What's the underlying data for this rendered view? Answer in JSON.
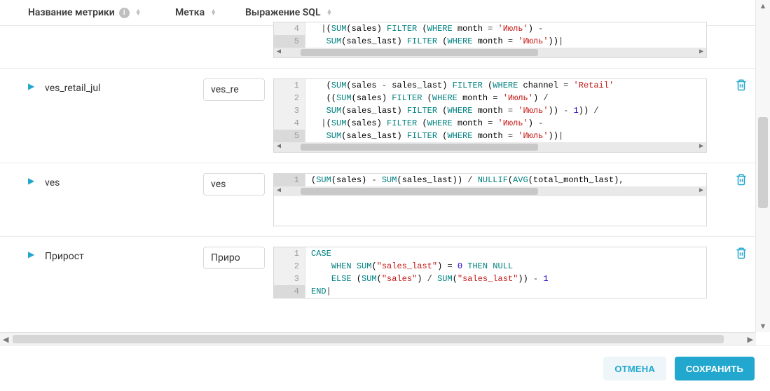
{
  "header": {
    "col_name": "Название метрики",
    "col_label": "Метка",
    "col_sql": "Выражение SQL"
  },
  "rows": [
    {
      "name": "",
      "label": "",
      "sql": [
        {
          "n": 4,
          "cls": "",
          "tokens": [
            [
              "",
              "  |"
            ],
            [
              "par",
              "("
            ],
            [
              "kw",
              "SUM"
            ],
            [
              "par",
              "("
            ],
            [
              "id",
              "sales"
            ],
            [
              "par",
              ")"
            ],
            [
              "",
              " "
            ],
            [
              "kw",
              "FILTER"
            ],
            [
              "",
              " "
            ],
            [
              "par",
              "("
            ],
            [
              "kw",
              "WHERE"
            ],
            [
              "",
              " "
            ],
            [
              "id",
              "month"
            ],
            [
              "",
              " = "
            ],
            [
              "str",
              "'Июль'"
            ],
            [
              "par",
              ")"
            ],
            [
              "",
              " -"
            ]
          ]
        },
        {
          "n": 5,
          "cls": "cur",
          "tokens": [
            [
              "",
              "   "
            ],
            [
              "kw",
              "SUM"
            ],
            [
              "par",
              "("
            ],
            [
              "id",
              "sales_last"
            ],
            [
              "par",
              ")"
            ],
            [
              "",
              " "
            ],
            [
              "kw",
              "FILTER"
            ],
            [
              "",
              " "
            ],
            [
              "par",
              "("
            ],
            [
              "kw",
              "WHERE"
            ],
            [
              "",
              " "
            ],
            [
              "id",
              "month"
            ],
            [
              "",
              " = "
            ],
            [
              "str",
              "'Июль'"
            ],
            [
              "par",
              ")"
            ],
            [
              "par",
              ")"
            ],
            [
              "",
              "|"
            ]
          ]
        }
      ],
      "hscroll": true,
      "partialTop": true
    },
    {
      "name": "ves_retail_jul",
      "label": "ves_re",
      "sql": [
        {
          "n": 1,
          "cls": "",
          "tokens": [
            [
              "",
              "   "
            ],
            [
              "par",
              "("
            ],
            [
              "kw",
              "SUM"
            ],
            [
              "par",
              "("
            ],
            [
              "id",
              "sales"
            ],
            [
              "",
              " - "
            ],
            [
              "id",
              "sales_last"
            ],
            [
              "par",
              ")"
            ],
            [
              "",
              " "
            ],
            [
              "kw",
              "FILTER"
            ],
            [
              "",
              " "
            ],
            [
              "par",
              "("
            ],
            [
              "kw",
              "WHERE"
            ],
            [
              "",
              " "
            ],
            [
              "id",
              "channel"
            ],
            [
              "",
              " = "
            ],
            [
              "str",
              "'Retail'"
            ],
            [
              "",
              "  "
            ]
          ]
        },
        {
          "n": 2,
          "cls": "",
          "tokens": [
            [
              "",
              "   "
            ],
            [
              "par",
              "(("
            ],
            [
              "kw",
              "SUM"
            ],
            [
              "par",
              "("
            ],
            [
              "id",
              "sales"
            ],
            [
              "par",
              ")"
            ],
            [
              "",
              " "
            ],
            [
              "kw",
              "FILTER"
            ],
            [
              "",
              " "
            ],
            [
              "par",
              "("
            ],
            [
              "kw",
              "WHERE"
            ],
            [
              "",
              " "
            ],
            [
              "id",
              "month"
            ],
            [
              "",
              " = "
            ],
            [
              "str",
              "'Июль'"
            ],
            [
              "par",
              ")"
            ],
            [
              "",
              " /"
            ]
          ]
        },
        {
          "n": 3,
          "cls": "",
          "tokens": [
            [
              "",
              "   "
            ],
            [
              "kw",
              "SUM"
            ],
            [
              "par",
              "("
            ],
            [
              "id",
              "sales_last"
            ],
            [
              "par",
              ")"
            ],
            [
              "",
              " "
            ],
            [
              "kw",
              "FILTER"
            ],
            [
              "",
              " "
            ],
            [
              "par",
              "("
            ],
            [
              "kw",
              "WHERE"
            ],
            [
              "",
              " "
            ],
            [
              "id",
              "month"
            ],
            [
              "",
              " = "
            ],
            [
              "str",
              "'Июль'"
            ],
            [
              "par",
              ")"
            ],
            [
              "par",
              ")"
            ],
            [
              "",
              " - "
            ],
            [
              "num",
              "1"
            ],
            [
              "par",
              "))"
            ],
            [
              "",
              " /"
            ]
          ]
        },
        {
          "n": 4,
          "cls": "",
          "tokens": [
            [
              "",
              "  |"
            ],
            [
              "par",
              "("
            ],
            [
              "kw",
              "SUM"
            ],
            [
              "par",
              "("
            ],
            [
              "id",
              "sales"
            ],
            [
              "par",
              ")"
            ],
            [
              "",
              " "
            ],
            [
              "kw",
              "FILTER"
            ],
            [
              "",
              " "
            ],
            [
              "par",
              "("
            ],
            [
              "kw",
              "WHERE"
            ],
            [
              "",
              " "
            ],
            [
              "id",
              "month"
            ],
            [
              "",
              " = "
            ],
            [
              "str",
              "'Июль'"
            ],
            [
              "par",
              ")"
            ],
            [
              "",
              " -"
            ]
          ]
        },
        {
          "n": 5,
          "cls": "cur",
          "tokens": [
            [
              "",
              "   "
            ],
            [
              "kw",
              "SUM"
            ],
            [
              "par",
              "("
            ],
            [
              "id",
              "sales_last"
            ],
            [
              "par",
              ")"
            ],
            [
              "",
              " "
            ],
            [
              "kw",
              "FILTER"
            ],
            [
              "",
              " "
            ],
            [
              "par",
              "("
            ],
            [
              "kw",
              "WHERE"
            ],
            [
              "",
              " "
            ],
            [
              "id",
              "month"
            ],
            [
              "",
              " = "
            ],
            [
              "str",
              "'Июль'"
            ],
            [
              "par",
              ")"
            ],
            [
              "par",
              ")"
            ],
            [
              "",
              "|"
            ]
          ]
        }
      ],
      "hscroll": true
    },
    {
      "name": "ves",
      "label": "ves",
      "sql": [
        {
          "n": 1,
          "cls": "cur",
          "tokens": [
            [
              "par",
              "("
            ],
            [
              "kw",
              "SUM"
            ],
            [
              "par",
              "("
            ],
            [
              "id",
              "sales"
            ],
            [
              "par",
              ")"
            ],
            [
              "",
              " - "
            ],
            [
              "kw",
              "SUM"
            ],
            [
              "par",
              "("
            ],
            [
              "id",
              "sales_last"
            ],
            [
              "par",
              "))"
            ],
            [
              "",
              " / "
            ],
            [
              "kw",
              "NULLIF"
            ],
            [
              "par",
              "("
            ],
            [
              "kw",
              "AVG"
            ],
            [
              "par",
              "("
            ],
            [
              "id",
              "total_month_last"
            ],
            [
              "par",
              ")"
            ],
            [
              "",
              ","
            ]
          ]
        }
      ],
      "hscroll": true,
      "tall": true
    },
    {
      "name": "Прирост",
      "label": "Приро",
      "sql": [
        {
          "n": 1,
          "cls": "",
          "tokens": [
            [
              "kw",
              "CASE"
            ]
          ]
        },
        {
          "n": 2,
          "cls": "",
          "tokens": [
            [
              "",
              "    "
            ],
            [
              "kw",
              "WHEN"
            ],
            [
              "",
              " "
            ],
            [
              "kw",
              "SUM"
            ],
            [
              "par",
              "("
            ],
            [
              "str",
              "\"sales_last\""
            ],
            [
              "par",
              ")"
            ],
            [
              "",
              " = "
            ],
            [
              "num",
              "0"
            ],
            [
              "",
              " "
            ],
            [
              "kw",
              "THEN"
            ],
            [
              "",
              " "
            ],
            [
              "kw",
              "NULL"
            ]
          ]
        },
        {
          "n": 3,
          "cls": "",
          "tokens": [
            [
              "",
              "    "
            ],
            [
              "kw",
              "ELSE"
            ],
            [
              "",
              " "
            ],
            [
              "par",
              "("
            ],
            [
              "kw",
              "SUM"
            ],
            [
              "par",
              "("
            ],
            [
              "str",
              "\"sales\""
            ],
            [
              "par",
              ")"
            ],
            [
              "",
              " / "
            ],
            [
              "kw",
              "SUM"
            ],
            [
              "par",
              "("
            ],
            [
              "str",
              "\"sales_last\""
            ],
            [
              "par",
              "))"
            ],
            [
              "",
              " - "
            ],
            [
              "num",
              "1"
            ]
          ]
        },
        {
          "n": 4,
          "cls": "cur",
          "tokens": [
            [
              "kw",
              "END"
            ],
            [
              "",
              "|"
            ]
          ]
        }
      ],
      "hscroll": false,
      "noBottomBorder": true
    }
  ],
  "footer": {
    "cancel": "ОТМЕНА",
    "save": "СОХРАНИТЬ"
  }
}
